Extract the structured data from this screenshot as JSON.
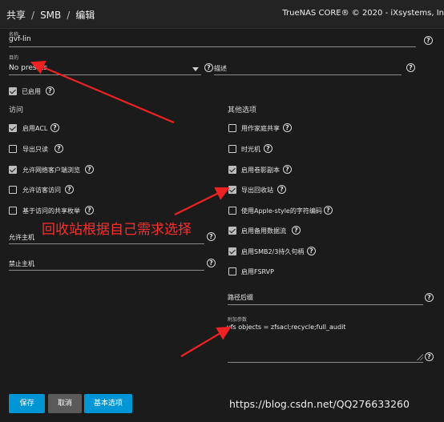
{
  "breadcrumb": {
    "item1": "共享",
    "item2": "SMB",
    "item3": "编辑"
  },
  "brand": "TrueNAS CORE® © 2020 - iXsystems, In",
  "name_field": {
    "label": "名称",
    "value": "gvf-lin"
  },
  "purpose_field": {
    "label": "目的",
    "value": "No presets"
  },
  "description_field": {
    "label": "描述",
    "value": ""
  },
  "enabled": {
    "label": "已启用",
    "checked": true
  },
  "access": {
    "title": "访问",
    "options": [
      {
        "label": "启用ACL",
        "checked": true
      },
      {
        "label": "导出只读",
        "checked": false
      },
      {
        "label": "允许网络客户端浏览",
        "checked": true
      },
      {
        "label": "允许访客访问",
        "checked": false
      },
      {
        "label": "基于访问的共享枚举",
        "checked": false
      }
    ],
    "hosts_allow": {
      "label": "允许主机",
      "value": ""
    },
    "hosts_deny": {
      "label": "禁止主机",
      "value": ""
    }
  },
  "other": {
    "title": "其他选项",
    "options": [
      {
        "label": "用作家庭共享",
        "checked": false
      },
      {
        "label": "时光机",
        "checked": false
      },
      {
        "label": "启用卷影副本",
        "checked": true
      },
      {
        "label": "导出回收站",
        "checked": true
      },
      {
        "label": "使用Apple-style的字符编码",
        "checked": false
      },
      {
        "label": "启用备用数据流",
        "checked": true
      },
      {
        "label": "启用SMB2/3持久句柄",
        "checked": true
      },
      {
        "label": "启用FSRVP",
        "checked": false
      }
    ],
    "path_suffix": {
      "label": "路径后缀",
      "value": ""
    },
    "aux_params": {
      "label": "附加参数",
      "value": "vfs objects = zfsacl;recycle;full_audit"
    }
  },
  "buttons": {
    "save": "保存",
    "cancel": "取消",
    "basic": "基本选项"
  },
  "annotation": {
    "text": "回收站根据自己需求选择",
    "color": "#ff2d2d"
  },
  "watermark": "https://blog.csdn.net/QQ276633260",
  "colors": {
    "accent": "#0095d5",
    "background": "#1b1b1b",
    "annotation": "#ff2d2d"
  }
}
